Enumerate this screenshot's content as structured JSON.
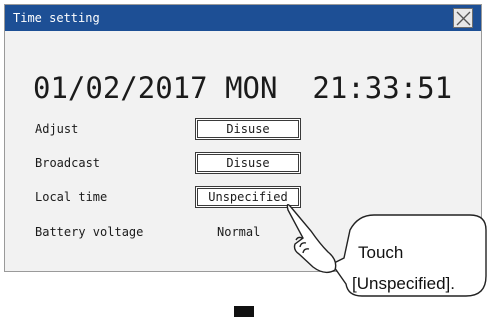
{
  "window": {
    "title": "Time setting",
    "close_icon": "close-icon",
    "title_bar_color": "#1d4f95"
  },
  "datetime": {
    "date": "01/02/2017",
    "weekday": "MON",
    "time": "21:33:51"
  },
  "settings": [
    {
      "label": "Adjust",
      "value": "Disuse",
      "type": "button"
    },
    {
      "label": "Broadcast",
      "value": "Disuse",
      "type": "button"
    },
    {
      "label": "Local time",
      "value": "Unspecified",
      "type": "button"
    },
    {
      "label": "Battery voltage",
      "value": "Normal",
      "type": "text"
    }
  ],
  "callout": {
    "line1": "Touch",
    "line2": "[Unspecified].",
    "icon": "hand-pointer-icon"
  },
  "next_step_icon": "down-arrow-icon"
}
